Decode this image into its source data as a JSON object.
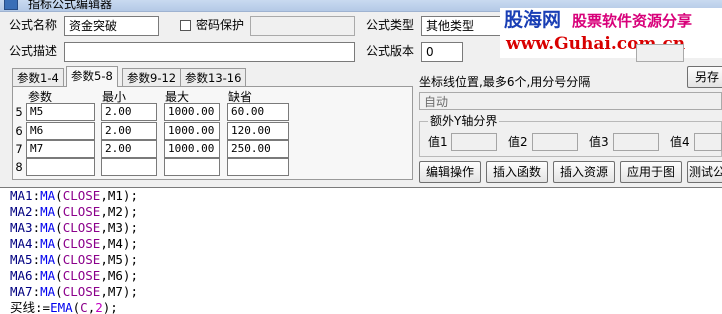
{
  "window": {
    "title": "指标公式编辑器"
  },
  "watermark": {
    "brand": "股海网",
    "slogan": "股票软件资源分享",
    "url": "www.Guhai.com.cn"
  },
  "form": {
    "name_label": "公式名称",
    "name_value": "资金突破",
    "password_label": "密码保护",
    "password_checked": false,
    "type_label": "公式类型",
    "type_value": "其他类型",
    "desc_label": "公式描述",
    "desc_value": "",
    "version_label": "公式版本",
    "version_value": "0"
  },
  "tabs": [
    {
      "label": "参数1-4",
      "active": false
    },
    {
      "label": "参数5-8",
      "active": true
    },
    {
      "label": "参数9-12",
      "active": false
    },
    {
      "label": "参数13-16",
      "active": false
    }
  ],
  "params": {
    "headers": {
      "name": "参数",
      "min": "最小",
      "max": "最大",
      "default": "缺省"
    },
    "rows": [
      {
        "num": "5",
        "name": "M5",
        "min": "2.00",
        "max": "1000.00",
        "default": "60.00"
      },
      {
        "num": "6",
        "name": "M6",
        "min": "2.00",
        "max": "1000.00",
        "default": "120.00"
      },
      {
        "num": "7",
        "name": "M7",
        "min": "2.00",
        "max": "1000.00",
        "default": "250.00"
      },
      {
        "num": "8",
        "name": "",
        "min": "",
        "max": "",
        "default": ""
      }
    ]
  },
  "axis": {
    "label": "坐标线位置,最多6个,用分号分隔",
    "value": "自动",
    "right_button": "另存"
  },
  "extra_y": {
    "legend": "额外Y轴分界",
    "labels": [
      "值1",
      "值2",
      "值3",
      "值4"
    ]
  },
  "buttons": {
    "edit_ops": "编辑操作",
    "insert_func": "插入函数",
    "insert_resource": "插入资源",
    "apply_chart": "应用于图",
    "test": "测试公"
  },
  "code": {
    "lines": [
      [
        {
          "t": "MA1",
          "c": "var"
        },
        {
          "t": ":",
          "c": "punc"
        },
        {
          "t": "MA",
          "c": "func"
        },
        {
          "t": "(",
          "c": "punc"
        },
        {
          "t": "CLOSE",
          "c": "const"
        },
        {
          "t": ",M1);",
          "c": "punc"
        }
      ],
      [
        {
          "t": "MA2",
          "c": "var"
        },
        {
          "t": ":",
          "c": "punc"
        },
        {
          "t": "MA",
          "c": "func"
        },
        {
          "t": "(",
          "c": "punc"
        },
        {
          "t": "CLOSE",
          "c": "const"
        },
        {
          "t": ",M2);",
          "c": "punc"
        }
      ],
      [
        {
          "t": "MA3",
          "c": "var"
        },
        {
          "t": ":",
          "c": "punc"
        },
        {
          "t": "MA",
          "c": "func"
        },
        {
          "t": "(",
          "c": "punc"
        },
        {
          "t": "CLOSE",
          "c": "const"
        },
        {
          "t": ",M3);",
          "c": "punc"
        }
      ],
      [
        {
          "t": "MA4",
          "c": "var"
        },
        {
          "t": ":",
          "c": "punc"
        },
        {
          "t": "MA",
          "c": "func"
        },
        {
          "t": "(",
          "c": "punc"
        },
        {
          "t": "CLOSE",
          "c": "const"
        },
        {
          "t": ",M4);",
          "c": "punc"
        }
      ],
      [
        {
          "t": "MA5",
          "c": "var"
        },
        {
          "t": ":",
          "c": "punc"
        },
        {
          "t": "MA",
          "c": "func"
        },
        {
          "t": "(",
          "c": "punc"
        },
        {
          "t": "CLOSE",
          "c": "const"
        },
        {
          "t": ",M5);",
          "c": "punc"
        }
      ],
      [
        {
          "t": "MA6",
          "c": "var"
        },
        {
          "t": ":",
          "c": "punc"
        },
        {
          "t": "MA",
          "c": "func"
        },
        {
          "t": "(",
          "c": "punc"
        },
        {
          "t": "CLOSE",
          "c": "const"
        },
        {
          "t": ",M6);",
          "c": "punc"
        }
      ],
      [
        {
          "t": "MA7",
          "c": "var"
        },
        {
          "t": ":",
          "c": "punc"
        },
        {
          "t": "MA",
          "c": "func"
        },
        {
          "t": "(",
          "c": "punc"
        },
        {
          "t": "CLOSE",
          "c": "const"
        },
        {
          "t": ",M7);",
          "c": "punc"
        }
      ],
      [
        {
          "t": "买线:=",
          "c": "punc"
        },
        {
          "t": "EMA",
          "c": "func"
        },
        {
          "t": "(",
          "c": "punc"
        },
        {
          "t": "C",
          "c": "const"
        },
        {
          "t": ",",
          "c": "punc"
        },
        {
          "t": "2",
          "c": "num"
        },
        {
          "t": ");",
          "c": "punc"
        }
      ]
    ]
  },
  "colors": {
    "watermark_brand": "#1a3fb5",
    "watermark_slogan": "#d8007a",
    "watermark_url": "#d80000"
  }
}
